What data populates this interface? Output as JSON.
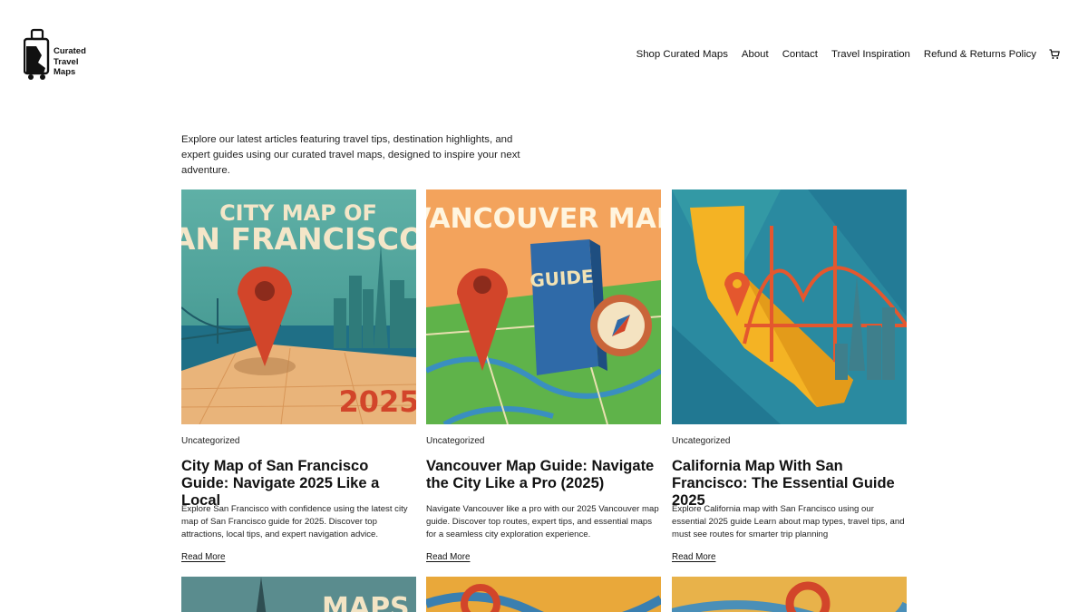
{
  "header": {
    "logo": {
      "line1": "Curated",
      "line2": "Travel",
      "line3": "Maps"
    },
    "nav": [
      {
        "label": "Shop Curated Maps"
      },
      {
        "label": "About"
      },
      {
        "label": "Contact"
      },
      {
        "label": "Travel Inspiration"
      },
      {
        "label": "Refund & Returns Policy"
      }
    ],
    "cart_icon": "cart-icon"
  },
  "intro": "Explore our latest articles featuring travel tips, destination highlights, and expert guides using our curated travel maps, designed to inspire your next adventure.",
  "posts": [
    {
      "image_text_1": "CITY MAP OF",
      "image_text_2": "AN FRANCISCO",
      "image_text_3": "2025",
      "category": "Uncategorized",
      "title": "City Map of San Francisco Guide: Navigate 2025 Like a Local",
      "excerpt": "Explore San Francisco with confidence using the latest city map of San Francisco guide for 2025. Discover top attractions, local tips, and expert navigation advice.",
      "read_more": "Read More"
    },
    {
      "image_text_1": "VANCOUVER MAP",
      "image_text_2": "GUIDE",
      "category": "Uncategorized",
      "title": "Vancouver Map Guide: Navigate the City Like a Pro (2025)",
      "excerpt": "Navigate Vancouver like a pro with our 2025 Vancouver map guide. Discover top routes, expert tips, and essential maps for a seamless city exploration experience.",
      "read_more": "Read More"
    },
    {
      "category": "Uncategorized",
      "title": "California Map With San Francisco: The Essential Guide 2025",
      "excerpt": "Explore California map with San Francisco using our essential 2025 guide Learn about map types, travel tips, and must see routes for smarter trip planning",
      "read_more": "Read More"
    }
  ],
  "row2": [
    {
      "image_text": "MAPS O"
    }
  ],
  "colors": {
    "sky_teal": "#2d8a8a",
    "pin_red": "#d2452a",
    "sand": "#e8b170",
    "orange_bg": "#f0a860",
    "grass_green": "#5fb34a",
    "book_blue": "#2f6aa8",
    "ca_yellow": "#f4b324",
    "bridge_orange": "#e4572e"
  }
}
